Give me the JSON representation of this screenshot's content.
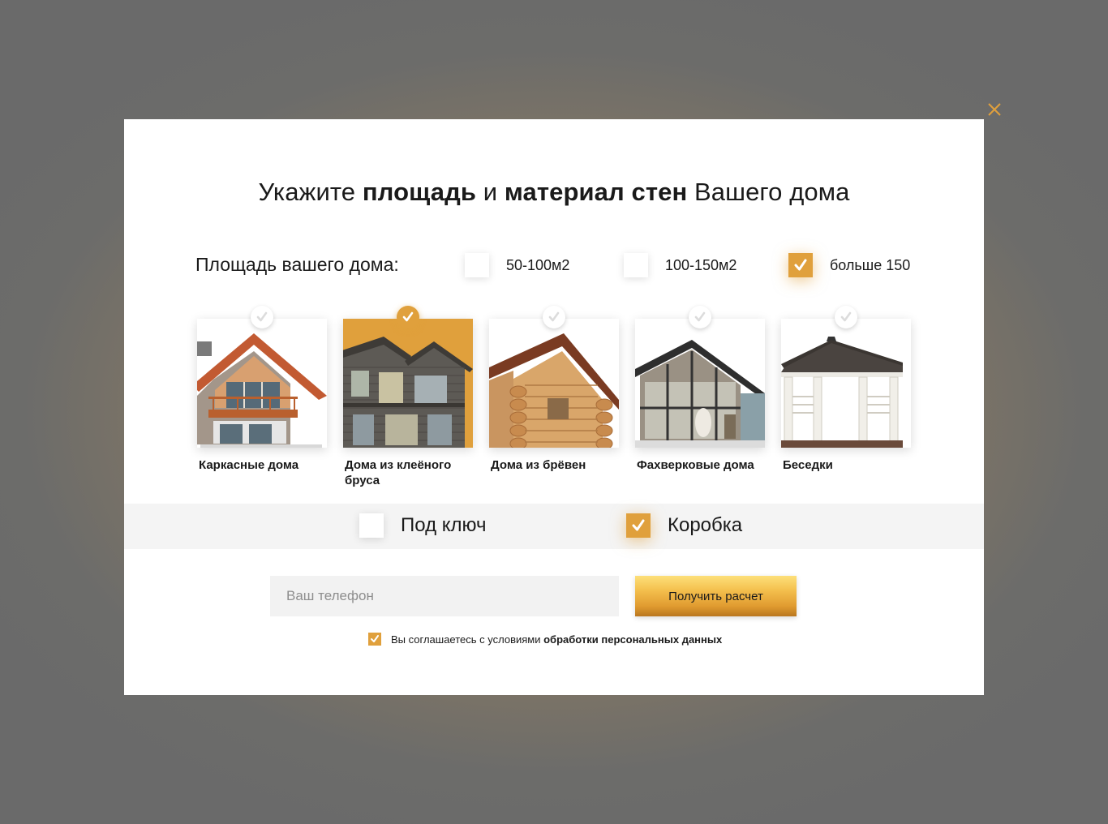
{
  "modal": {
    "title": {
      "part1": "Укажите ",
      "bold1": "площадь",
      "part2": " и ",
      "bold2": "материал стен",
      "part3": " Вашего дома"
    },
    "area": {
      "label": "Площадь вашего дома:",
      "options": [
        {
          "label": "50-100м2",
          "checked": false
        },
        {
          "label": "100-150м2",
          "checked": false
        },
        {
          "label": "больше 150",
          "checked": true
        }
      ]
    },
    "house_types": [
      {
        "label": "Каркасные дома",
        "selected": false,
        "icon": "frame-house-image"
      },
      {
        "label": "Дома из клеёного бруса",
        "selected": true,
        "icon": "glued-beam-house-image"
      },
      {
        "label": "Дома из брёвен",
        "selected": false,
        "icon": "log-house-image"
      },
      {
        "label": "Фахверковые дома",
        "selected": false,
        "icon": "half-timbered-house-image"
      },
      {
        "label": "Беседки",
        "selected": false,
        "icon": "gazebo-image"
      }
    ],
    "kit": [
      {
        "label": "Под ключ",
        "checked": false
      },
      {
        "label": "Коробка",
        "checked": true
      }
    ],
    "form": {
      "phone_placeholder": "Ваш телефон",
      "submit_label": "Получить расчет"
    },
    "consent": {
      "text": "Вы соглашаетесь с условиями ",
      "link": "обработки персональных данных",
      "checked": true
    }
  },
  "colors": {
    "accent": "#e0a03c",
    "close": "#e0a03c",
    "strip": "#f4f4f4"
  }
}
